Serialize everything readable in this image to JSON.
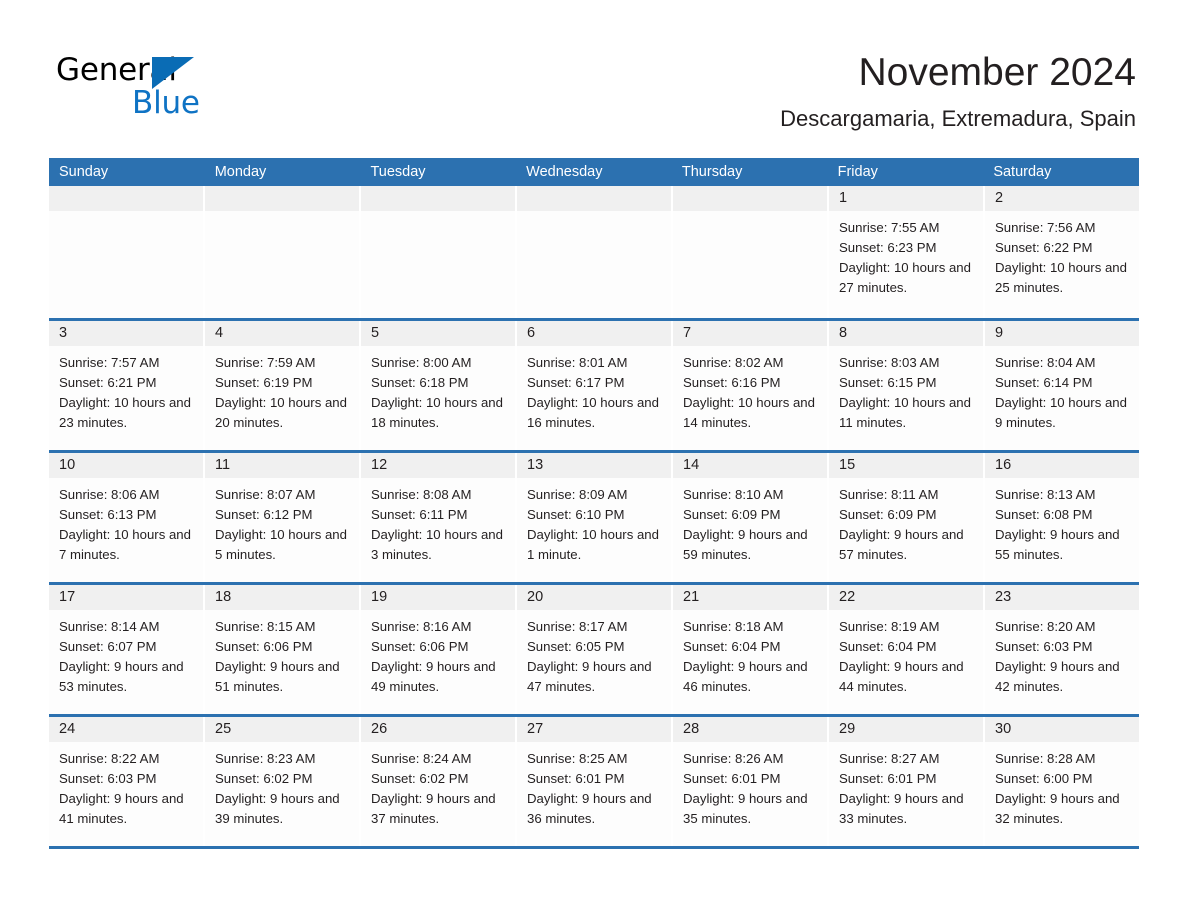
{
  "brand": {
    "name_top": "General",
    "name_bottom": "Blue",
    "triangle_color": "#0a6cb5",
    "blue_color": "#0f73c4"
  },
  "header": {
    "month_title": "November 2024",
    "location": "Descargamaria, Extremadura, Spain"
  },
  "theme": {
    "accent": "#2c71b0",
    "daynum_band": "#f0f0f0",
    "text": "#231f20"
  },
  "weekdays": [
    "Sunday",
    "Monday",
    "Tuesday",
    "Wednesday",
    "Thursday",
    "Friday",
    "Saturday"
  ],
  "labels": {
    "sunrise": "Sunrise:",
    "sunset": "Sunset:",
    "daylight": "Daylight:"
  },
  "weeks": [
    [
      {
        "day": ""
      },
      {
        "day": ""
      },
      {
        "day": ""
      },
      {
        "day": ""
      },
      {
        "day": ""
      },
      {
        "day": "1",
        "sunrise": "Sunrise: 7:55 AM",
        "sunset": "Sunset: 6:23 PM",
        "daylight": "Daylight: 10 hours and 27 minutes."
      },
      {
        "day": "2",
        "sunrise": "Sunrise: 7:56 AM",
        "sunset": "Sunset: 6:22 PM",
        "daylight": "Daylight: 10 hours and 25 minutes."
      }
    ],
    [
      {
        "day": "3",
        "sunrise": "Sunrise: 7:57 AM",
        "sunset": "Sunset: 6:21 PM",
        "daylight": "Daylight: 10 hours and 23 minutes."
      },
      {
        "day": "4",
        "sunrise": "Sunrise: 7:59 AM",
        "sunset": "Sunset: 6:19 PM",
        "daylight": "Daylight: 10 hours and 20 minutes."
      },
      {
        "day": "5",
        "sunrise": "Sunrise: 8:00 AM",
        "sunset": "Sunset: 6:18 PM",
        "daylight": "Daylight: 10 hours and 18 minutes."
      },
      {
        "day": "6",
        "sunrise": "Sunrise: 8:01 AM",
        "sunset": "Sunset: 6:17 PM",
        "daylight": "Daylight: 10 hours and 16 minutes."
      },
      {
        "day": "7",
        "sunrise": "Sunrise: 8:02 AM",
        "sunset": "Sunset: 6:16 PM",
        "daylight": "Daylight: 10 hours and 14 minutes."
      },
      {
        "day": "8",
        "sunrise": "Sunrise: 8:03 AM",
        "sunset": "Sunset: 6:15 PM",
        "daylight": "Daylight: 10 hours and 11 minutes."
      },
      {
        "day": "9",
        "sunrise": "Sunrise: 8:04 AM",
        "sunset": "Sunset: 6:14 PM",
        "daylight": "Daylight: 10 hours and 9 minutes."
      }
    ],
    [
      {
        "day": "10",
        "sunrise": "Sunrise: 8:06 AM",
        "sunset": "Sunset: 6:13 PM",
        "daylight": "Daylight: 10 hours and 7 minutes."
      },
      {
        "day": "11",
        "sunrise": "Sunrise: 8:07 AM",
        "sunset": "Sunset: 6:12 PM",
        "daylight": "Daylight: 10 hours and 5 minutes."
      },
      {
        "day": "12",
        "sunrise": "Sunrise: 8:08 AM",
        "sunset": "Sunset: 6:11 PM",
        "daylight": "Daylight: 10 hours and 3 minutes."
      },
      {
        "day": "13",
        "sunrise": "Sunrise: 8:09 AM",
        "sunset": "Sunset: 6:10 PM",
        "daylight": "Daylight: 10 hours and 1 minute."
      },
      {
        "day": "14",
        "sunrise": "Sunrise: 8:10 AM",
        "sunset": "Sunset: 6:09 PM",
        "daylight": "Daylight: 9 hours and 59 minutes."
      },
      {
        "day": "15",
        "sunrise": "Sunrise: 8:11 AM",
        "sunset": "Sunset: 6:09 PM",
        "daylight": "Daylight: 9 hours and 57 minutes."
      },
      {
        "day": "16",
        "sunrise": "Sunrise: 8:13 AM",
        "sunset": "Sunset: 6:08 PM",
        "daylight": "Daylight: 9 hours and 55 minutes."
      }
    ],
    [
      {
        "day": "17",
        "sunrise": "Sunrise: 8:14 AM",
        "sunset": "Sunset: 6:07 PM",
        "daylight": "Daylight: 9 hours and 53 minutes."
      },
      {
        "day": "18",
        "sunrise": "Sunrise: 8:15 AM",
        "sunset": "Sunset: 6:06 PM",
        "daylight": "Daylight: 9 hours and 51 minutes."
      },
      {
        "day": "19",
        "sunrise": "Sunrise: 8:16 AM",
        "sunset": "Sunset: 6:06 PM",
        "daylight": "Daylight: 9 hours and 49 minutes."
      },
      {
        "day": "20",
        "sunrise": "Sunrise: 8:17 AM",
        "sunset": "Sunset: 6:05 PM",
        "daylight": "Daylight: 9 hours and 47 minutes."
      },
      {
        "day": "21",
        "sunrise": "Sunrise: 8:18 AM",
        "sunset": "Sunset: 6:04 PM",
        "daylight": "Daylight: 9 hours and 46 minutes."
      },
      {
        "day": "22",
        "sunrise": "Sunrise: 8:19 AM",
        "sunset": "Sunset: 6:04 PM",
        "daylight": "Daylight: 9 hours and 44 minutes."
      },
      {
        "day": "23",
        "sunrise": "Sunrise: 8:20 AM",
        "sunset": "Sunset: 6:03 PM",
        "daylight": "Daylight: 9 hours and 42 minutes."
      }
    ],
    [
      {
        "day": "24",
        "sunrise": "Sunrise: 8:22 AM",
        "sunset": "Sunset: 6:03 PM",
        "daylight": "Daylight: 9 hours and 41 minutes."
      },
      {
        "day": "25",
        "sunrise": "Sunrise: 8:23 AM",
        "sunset": "Sunset: 6:02 PM",
        "daylight": "Daylight: 9 hours and 39 minutes."
      },
      {
        "day": "26",
        "sunrise": "Sunrise: 8:24 AM",
        "sunset": "Sunset: 6:02 PM",
        "daylight": "Daylight: 9 hours and 37 minutes."
      },
      {
        "day": "27",
        "sunrise": "Sunrise: 8:25 AM",
        "sunset": "Sunset: 6:01 PM",
        "daylight": "Daylight: 9 hours and 36 minutes."
      },
      {
        "day": "28",
        "sunrise": "Sunrise: 8:26 AM",
        "sunset": "Sunset: 6:01 PM",
        "daylight": "Daylight: 9 hours and 35 minutes."
      },
      {
        "day": "29",
        "sunrise": "Sunrise: 8:27 AM",
        "sunset": "Sunset: 6:01 PM",
        "daylight": "Daylight: 9 hours and 33 minutes."
      },
      {
        "day": "30",
        "sunrise": "Sunrise: 8:28 AM",
        "sunset": "Sunset: 6:00 PM",
        "daylight": "Daylight: 9 hours and 32 minutes."
      }
    ]
  ]
}
